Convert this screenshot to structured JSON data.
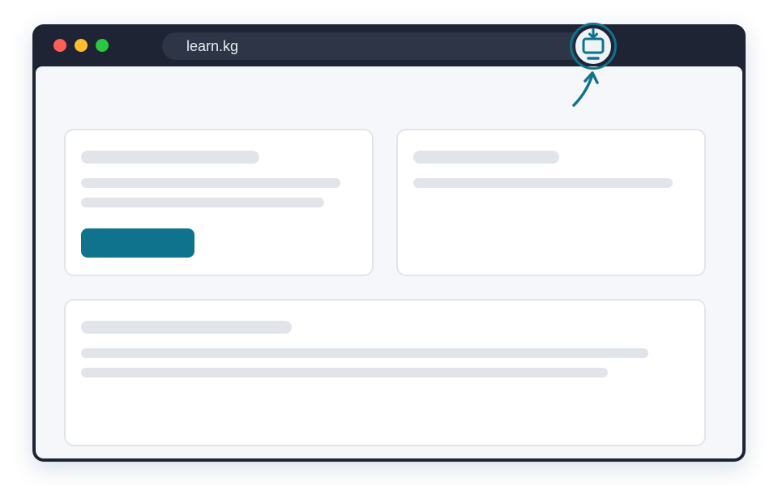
{
  "browser": {
    "url": "learn.kg",
    "install_icon": "install-app-icon",
    "accent_color": "#10738e",
    "traffic_lights": [
      "#ff5f57",
      "#febc2e",
      "#28c840"
    ]
  }
}
